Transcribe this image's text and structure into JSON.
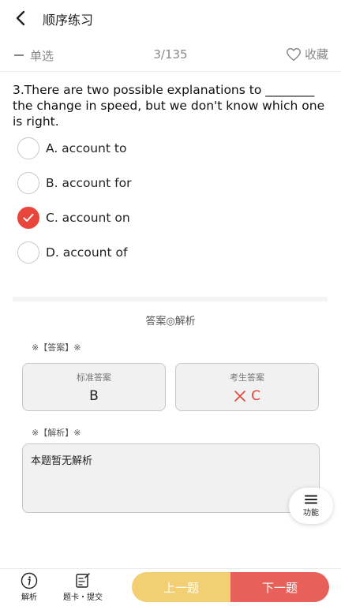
{
  "header": {
    "title": "顺序练习",
    "back_icon": "chevron-left-icon"
  },
  "subheader": {
    "question_type": "单选",
    "progress": "3/135",
    "favorite_label": "收藏",
    "favorite_icon": "heart-outline-icon"
  },
  "question": {
    "text": "3.There are two possible explanations to ________ the change in speed, but we don't know which one is right.",
    "options": [
      {
        "label": "A. account to",
        "selected": false
      },
      {
        "label": "B. account for",
        "selected": false
      },
      {
        "label": "C. account on",
        "selected": true
      },
      {
        "label": "D. account of",
        "selected": false
      }
    ]
  },
  "analysis_section": {
    "title": "答案◎解析",
    "answer_label": "※【答案】※",
    "standard_caption": "标准答案",
    "standard_value": "B",
    "user_caption": "考生答案",
    "user_value": "C",
    "analysis_label": "※【解析】※",
    "analysis_text": "本题暂无解析"
  },
  "function_button": {
    "label": "功能",
    "icon": "menu-icon"
  },
  "bottom_bar": {
    "analysis_label": "解析",
    "card_label": "题卡・提交",
    "prev_label": "上一题",
    "next_label": "下一题",
    "prev_color": "#f3cf74",
    "next_color": "#e8605a"
  },
  "colors": {
    "accent_red": "#e8463a",
    "wrong_red": "#e0433a"
  }
}
